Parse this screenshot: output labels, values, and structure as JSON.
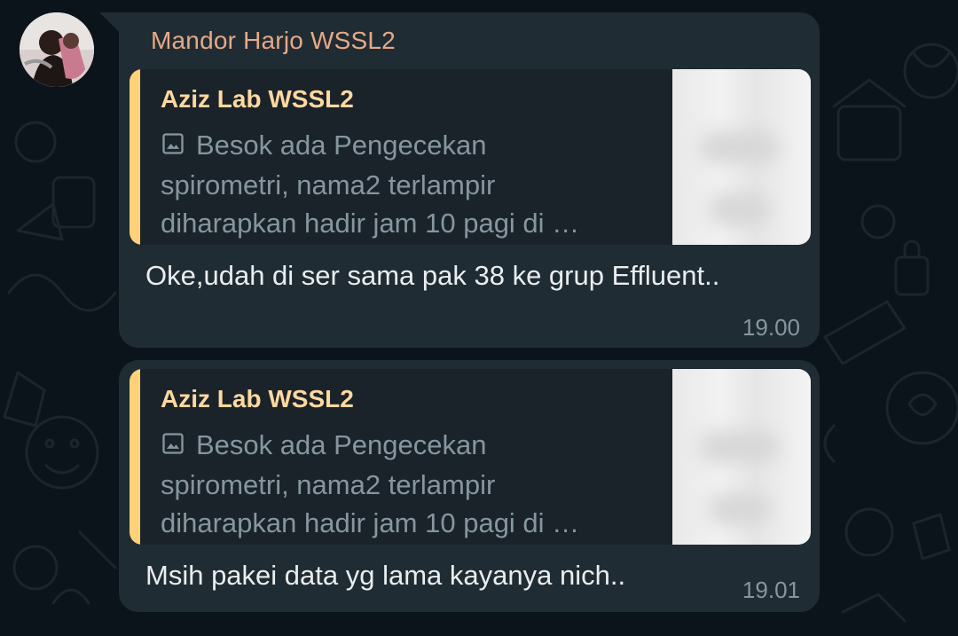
{
  "chat": {
    "group_sender": {
      "name": "Mandor Harjo WSSL2"
    },
    "messages": [
      {
        "reply_to": {
          "author": "Aziz Lab WSSL2",
          "preview": "Besok ada Pengecekan\nspirometri, nama2 terlampir\ndiharapkan hadir jam 10 pagi di …",
          "icon": "image-icon"
        },
        "text": "Oke,udah di ser sama pak 38 ke grup Effluent..",
        "time": "19.00"
      },
      {
        "reply_to": {
          "author": "Aziz Lab WSSL2",
          "preview": "Besok ada Pengecekan\nspirometri, nama2 terlampir\ndiharapkan hadir jam 10 pagi di …",
          "icon": "image-icon"
        },
        "text": "Msih pakei data yg lama kayanya nich..",
        "time": "19.01"
      }
    ]
  },
  "colors": {
    "background": "#0b141a",
    "bubble": "#202c33",
    "quote_bg": "#1a2329",
    "quote_bar": "#ffd279",
    "sender_name": "#e7a887",
    "quote_author": "#ffd8a0",
    "text": "#e9edef",
    "meta": "#8696a0"
  }
}
